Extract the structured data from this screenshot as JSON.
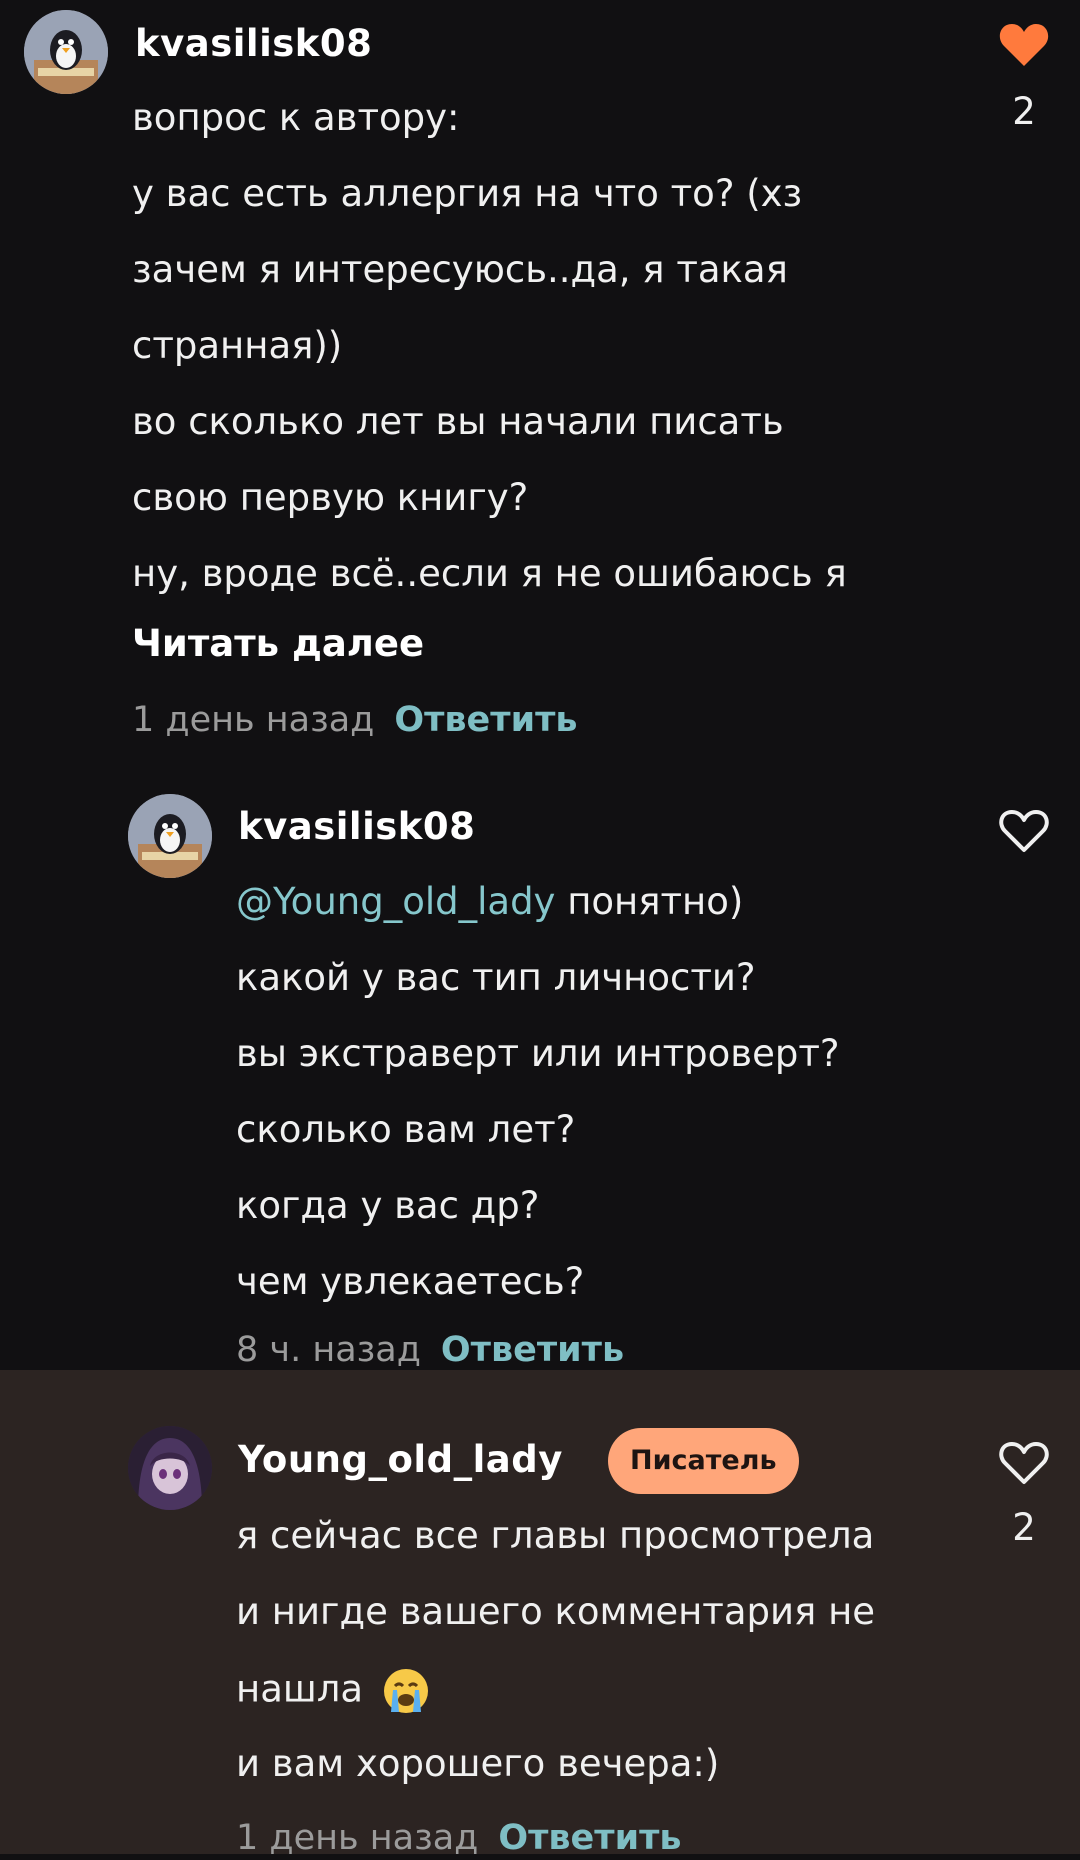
{
  "comments": [
    {
      "author": "kvasilisk08",
      "lines": [
        "вопрос к автору:",
        "у вас есть аллергия на что то? (хз",
        "зачем я интересуюсь..да, я такая",
        "странная))",
        "во сколько лет вы начали писать",
        "свою первую книгу?",
        "ну, вроде всё..если я не ошибаюсь я"
      ],
      "read_more": "Читать далее",
      "time": "1 день назад",
      "reply_label": "Ответить",
      "likes": "2",
      "liked": true,
      "avatar_icon": "penguin-avatar-icon"
    },
    {
      "author": "kvasilisk08",
      "mention": "@Young_old_lady",
      "first_line_rest": "понятно)",
      "lines": [
        "какой у вас тип личности?",
        "вы экстраверт или интроверт?",
        "сколько вам лет?",
        "когда у вас др?",
        "чем увлекаетесь?"
      ],
      "time": "8 ч. назад",
      "reply_label": "Ответить",
      "liked": false,
      "avatar_icon": "penguin-avatar-icon"
    },
    {
      "author": "Young_old_lady",
      "badge": "Писатель",
      "lines": [
        "я сейчас все главы просмотрела",
        "и нигде вашего комментария не",
        "нашла",
        "и вам хорошего вечера:)"
      ],
      "emoji": "crying-face-emoji",
      "time": "1 день назад",
      "reply_label": "Ответить",
      "likes": "2",
      "liked": false,
      "avatar_icon": "anime-girl-avatar-icon"
    }
  ],
  "colors": {
    "background": "#111012",
    "highlight_background": "#2c2422",
    "liked_heart": "#ff7a3d",
    "reply": "#7fbec4",
    "mention": "#86c7cc",
    "badge": "#ffa67a"
  }
}
